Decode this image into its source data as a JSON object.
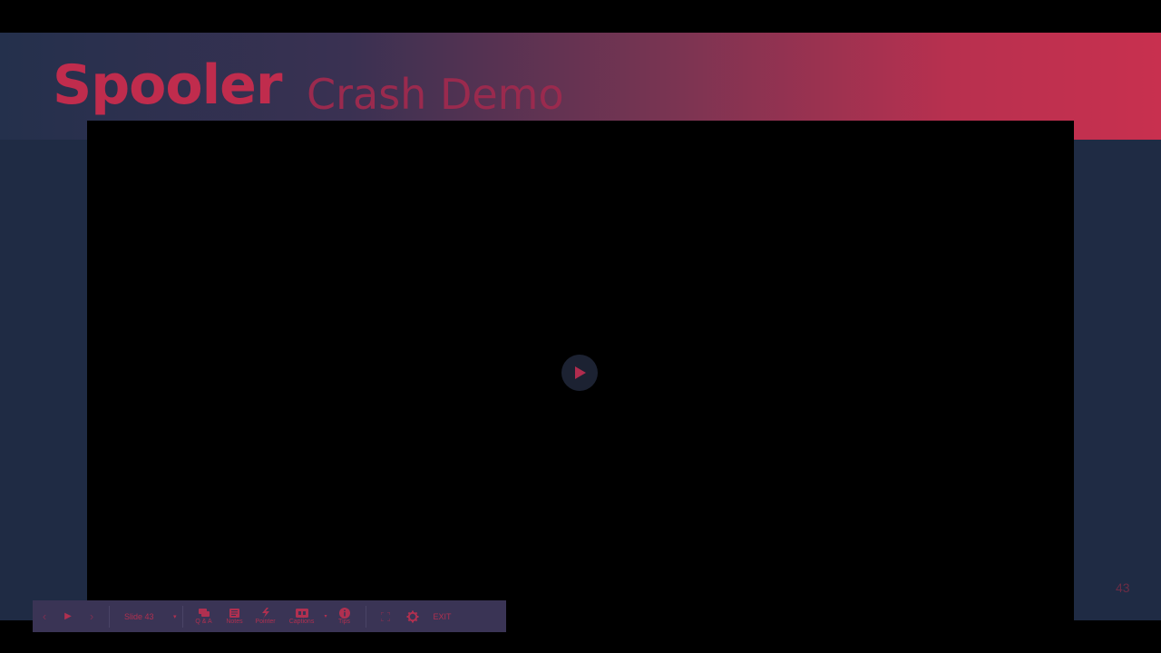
{
  "slide": {
    "title_bold": "Spooler",
    "title_rest": "Crash Demo",
    "page_number": "43"
  },
  "video": {
    "play_icon": "play-icon"
  },
  "toolbar": {
    "prev_icon": "‹",
    "play_icon": "▶",
    "next_icon": "›",
    "slide_select": "Slide 43",
    "slide_caret": "▾",
    "qa_label": "Q & A",
    "notes_label": "Notes",
    "pointer_label": "Pointer",
    "captions_label": "Captions",
    "captions_caret": "▾",
    "tips_label": "Tips",
    "exit_label": "EXIT"
  },
  "colors": {
    "accent": "#c02c4d",
    "slide_bg": "#1f2b44",
    "toolbar_bg": "#3a3455"
  }
}
